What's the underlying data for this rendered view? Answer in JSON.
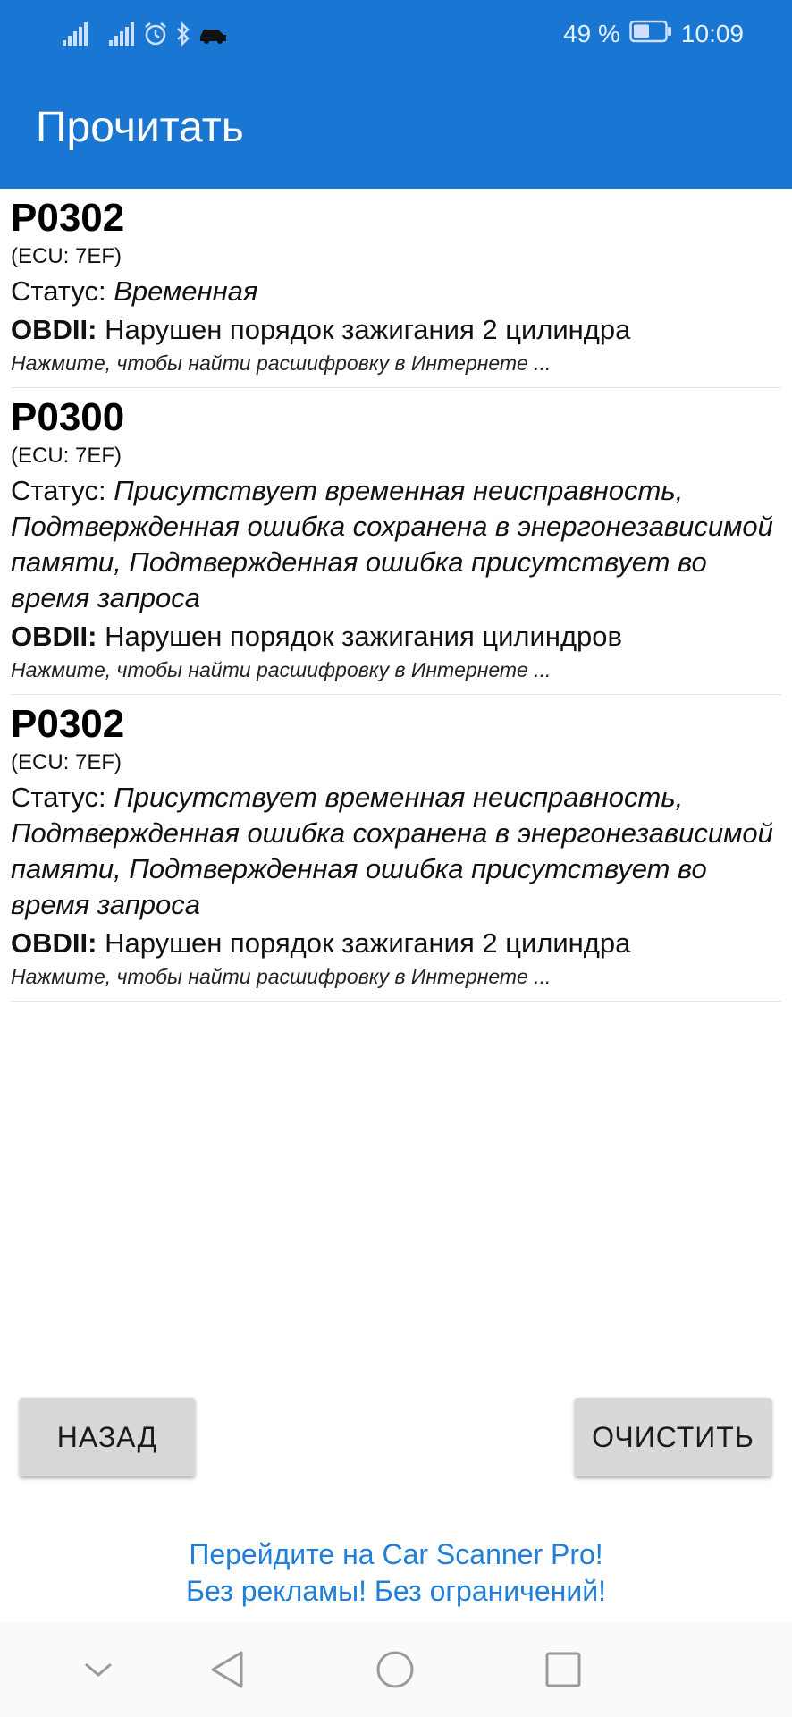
{
  "status_bar": {
    "battery_text": "49 %",
    "time": "10:09",
    "icons": [
      "signal-icon",
      "signal-icon",
      "alarm-icon",
      "bluetooth-icon",
      "car-icon",
      "battery-icon"
    ]
  },
  "app_bar": {
    "title": "Прочитать",
    "color": "#1976d2"
  },
  "dtc_items": [
    {
      "code": "P0302",
      "ecu": "(ECU: 7EF)",
      "status_label": "Статус:",
      "status_value": "Временная",
      "obd_label": "OBDII:",
      "obd_desc": "Нарушен порядок зажигания 2 цилиндра",
      "hint": "Нажмите, чтобы найти расшифровку в Интернете ..."
    },
    {
      "code": "P0300",
      "ecu": "(ECU: 7EF)",
      "status_label": "Статус:",
      "status_value": "Присутствует временная неисправность, Подтвержденная ошибка сохранена в энергонезависимой памяти, Подтвержденная ошибка присутствует во время запроса",
      "obd_label": "OBDII:",
      "obd_desc": "Нарушен порядок зажигания цилиндров",
      "hint": "Нажмите, чтобы найти расшифровку в Интернете ..."
    },
    {
      "code": "P0302",
      "ecu": "(ECU: 7EF)",
      "status_label": "Статус:",
      "status_value": "Присутствует временная неисправность, Подтвержденная ошибка сохранена в энергонезависимой памяти, Подтвержденная ошибка присутствует во время запроса",
      "obd_label": "OBDII:",
      "obd_desc": "Нарушен порядок зажигания 2 цилиндра",
      "hint": "Нажмите, чтобы найти расшифровку в Интернете ..."
    }
  ],
  "buttons": {
    "back_label": "НАЗАД",
    "clear_label": "ОЧИСТИТЬ"
  },
  "promo": {
    "line1": "Перейдите на Car Scanner Pro!",
    "line2": "Без рекламы! Без ограничений!",
    "color": "#1f7fd9"
  },
  "nav_bar": {
    "icons": [
      "chevron-down-icon",
      "back-triangle-icon",
      "home-circle-icon",
      "recents-square-icon"
    ]
  }
}
